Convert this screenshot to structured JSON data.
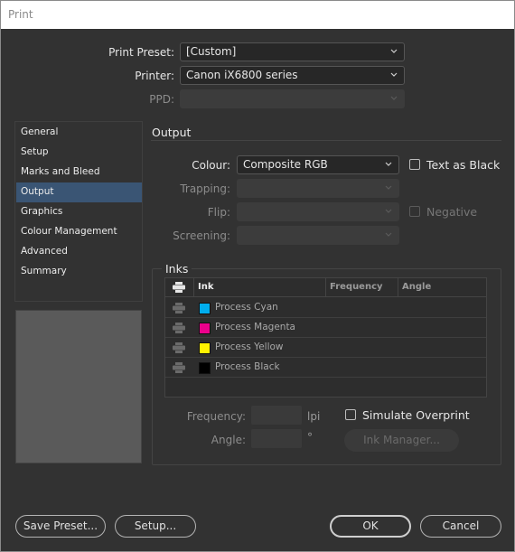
{
  "window": {
    "title": "Print"
  },
  "top_fields": {
    "print_preset": {
      "label": "Print Preset:",
      "value": "[Custom]"
    },
    "printer": {
      "label": "Printer:",
      "value": "Canon iX6800 series"
    },
    "ppd": {
      "label": "PPD:",
      "value": ""
    }
  },
  "sidebar": {
    "items": [
      {
        "label": "General",
        "active": false
      },
      {
        "label": "Setup",
        "active": false
      },
      {
        "label": "Marks and Bleed",
        "active": false
      },
      {
        "label": "Output",
        "active": true
      },
      {
        "label": "Graphics",
        "active": false
      },
      {
        "label": "Colour Management",
        "active": false
      },
      {
        "label": "Advanced",
        "active": false
      },
      {
        "label": "Summary",
        "active": false
      }
    ]
  },
  "output": {
    "title": "Output",
    "colour": {
      "label": "Colour:",
      "value": "Composite RGB"
    },
    "trapping": {
      "label": "Trapping:",
      "value": ""
    },
    "flip": {
      "label": "Flip:",
      "value": ""
    },
    "screening": {
      "label": "Screening:",
      "value": ""
    },
    "text_as_black": {
      "label": "Text as Black",
      "checked": false
    },
    "negative": {
      "label": "Negative",
      "checked": false,
      "disabled": true
    }
  },
  "inks": {
    "title": "Inks",
    "columns": {
      "print": "print-icon",
      "ink": "Ink",
      "frequency": "Frequency",
      "angle": "Angle"
    },
    "rows": [
      {
        "name": "Process Cyan",
        "color": "#00aeef"
      },
      {
        "name": "Process Magenta",
        "color": "#ec008c"
      },
      {
        "name": "Process Yellow",
        "color": "#fff200"
      },
      {
        "name": "Process Black",
        "color": "#000000"
      }
    ],
    "frequency": {
      "label": "Frequency:",
      "value": "",
      "unit": "lpi"
    },
    "angle": {
      "label": "Angle:",
      "value": "",
      "unit": "°"
    },
    "simulate_overprint": {
      "label": "Simulate Overprint",
      "checked": false
    },
    "ink_manager_label": "Ink Manager..."
  },
  "footer": {
    "save_preset": "Save Preset...",
    "setup": "Setup...",
    "ok": "OK",
    "cancel": "Cancel"
  }
}
